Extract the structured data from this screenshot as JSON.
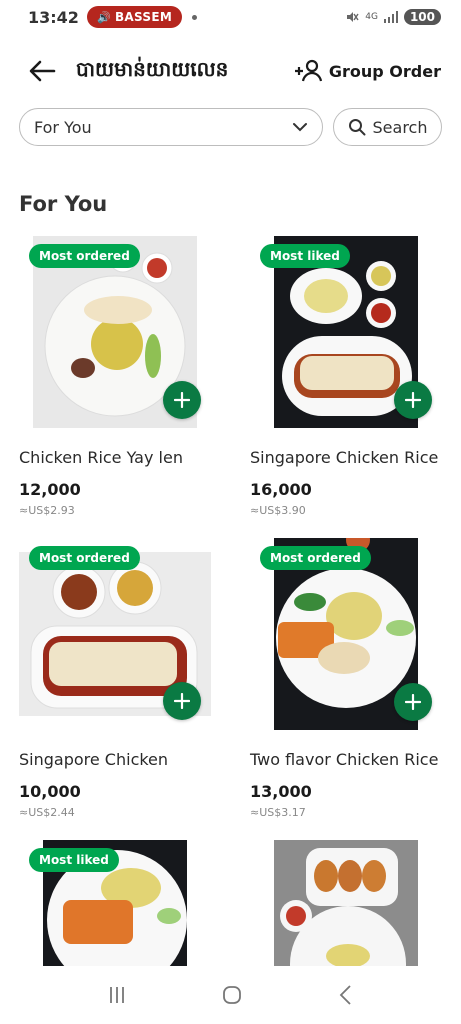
{
  "status_bar": {
    "time": "13:42",
    "call_label": "BASSEM",
    "network": "4G",
    "battery": "100"
  },
  "header": {
    "title": "បាយមាន់យាយលេន",
    "group_order_label": "Group Order",
    "back_icon": "arrow-left-icon",
    "group_icon": "add-group-icon"
  },
  "filters": {
    "category_value": "For You",
    "search_label": "Search"
  },
  "section": {
    "title": "For You"
  },
  "items": [
    {
      "badge": "Most ordered",
      "name": "Chicken Rice Yay len",
      "price": "12,000",
      "usd": "≈US$2.93"
    },
    {
      "badge": "Most liked",
      "name": "Singapore Chicken Rice",
      "price": "16,000",
      "usd": "≈US$3.90"
    },
    {
      "badge": "Most ordered",
      "name": "Singapore Chicken",
      "price": "10,000",
      "usd": "≈US$2.44"
    },
    {
      "badge": "Most ordered",
      "name": "Two flavor Chicken Rice",
      "price": "13,000",
      "usd": "≈US$3.17"
    },
    {
      "badge": "Most liked",
      "name": "",
      "price": "",
      "usd": ""
    },
    {
      "badge": "",
      "name": "",
      "price": "",
      "usd": ""
    }
  ],
  "colors": {
    "accent_green": "#00a650",
    "add_button": "#0a7a43",
    "call_pill": "#b5261e"
  }
}
